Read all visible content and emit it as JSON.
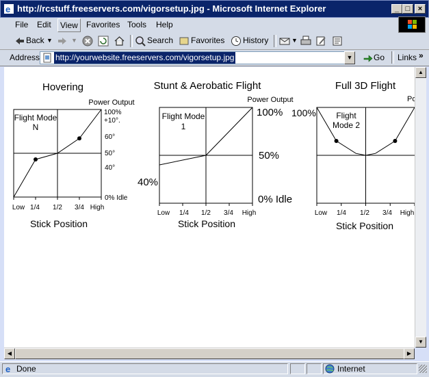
{
  "window": {
    "title": "http://rcstuff.freeservers.com/vigorsetup.jpg - Microsoft Internet Explorer"
  },
  "menu": [
    "File",
    "Edit",
    "View",
    "Favorites",
    "Tools",
    "Help"
  ],
  "toolbar": {
    "back": "Back",
    "search": "Search",
    "favorites": "Favorites",
    "history": "History"
  },
  "address": {
    "label": "Address",
    "url": "http://yourwebsite.freeservers.com/vigorsetup.jpg",
    "go": "Go",
    "links": "Links"
  },
  "status": {
    "text": "Done",
    "zone": "Internet"
  },
  "icons": [
    "ie-icon",
    "minimize-icon",
    "maximize-icon",
    "close-icon",
    "windows-logo-icon",
    "back-arrow-icon",
    "forward-arrow-icon",
    "stop-icon",
    "refresh-icon",
    "home-icon",
    "search-icon",
    "favorites-icon",
    "history-icon",
    "mail-icon",
    "print-icon",
    "edit-icon",
    "discuss-icon",
    "go-icon",
    "page-icon",
    "internet-icon"
  ],
  "chart_data": [
    {
      "type": "line",
      "title": "Hovering",
      "mode_label": [
        "Flight Mode",
        "N"
      ],
      "ylabel": "Power Output",
      "xlabel": "Stick Position",
      "x_ticks": [
        "Low",
        "1/4",
        "1/2",
        "3/4",
        "High"
      ],
      "y_labels": [
        "100%",
        "+10°.",
        "60°",
        "50°",
        "40°",
        "0% Idle"
      ],
      "x": [
        0,
        0.25,
        0.5,
        0.75,
        1
      ],
      "y": [
        0,
        43,
        50,
        67,
        100
      ],
      "marked_points": [
        0.25,
        0.75
      ]
    },
    {
      "type": "line",
      "title": "Stunt & Aerobatic Flight",
      "mode_label": [
        "Flight Mode",
        "1"
      ],
      "ylabel": "Power Output",
      "xlabel": "Stick Position",
      "x_ticks": [
        "Low",
        "1/4",
        "1/2",
        "3/4",
        "High"
      ],
      "y_labels_right": [
        "100%",
        "50%",
        "0% Idle"
      ],
      "y_label_left": "40%",
      "x": [
        0,
        0.5,
        1
      ],
      "y": [
        40,
        50,
        100
      ]
    },
    {
      "type": "line",
      "title": "Full 3D Flight",
      "mode_label": [
        "Flight",
        "Mode 2"
      ],
      "ylabel": "Po",
      "xlabel": "Stick Position",
      "x_ticks": [
        "Low",
        "1/4",
        "1/2",
        "3/4",
        "High"
      ],
      "y_label_left": "100%",
      "x": [
        0,
        0.2,
        0.4,
        0.5,
        0.6,
        0.8,
        1
      ],
      "y": [
        100,
        65,
        52,
        50,
        52,
        65,
        100
      ],
      "marked_points": [
        0.2,
        0.8
      ]
    }
  ]
}
